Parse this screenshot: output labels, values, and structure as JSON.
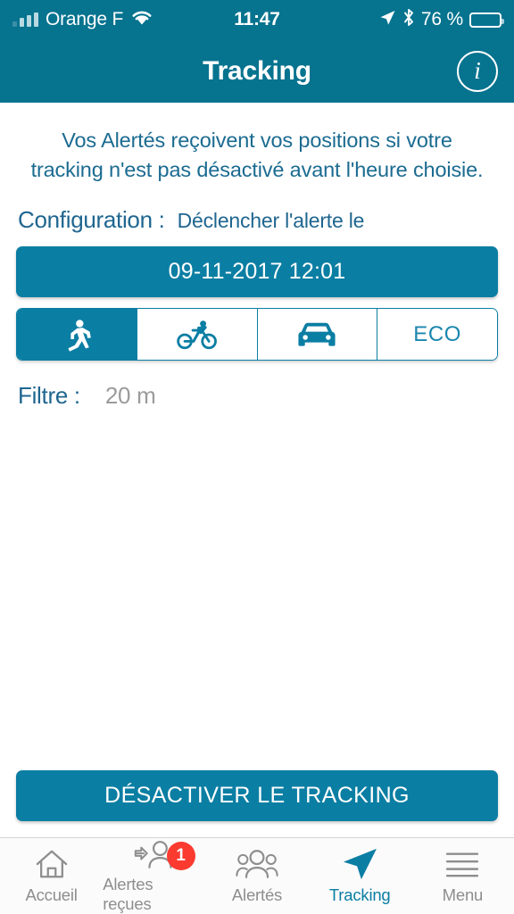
{
  "status_bar": {
    "carrier": "Orange F",
    "time": "11:47",
    "battery_percent_label": "76 %",
    "battery_level": 76,
    "signal_icon": "signal-bars-icon",
    "wifi_icon": "wifi-icon",
    "location_icon": "location-arrow-icon",
    "bluetooth_icon": "bluetooth-icon",
    "battery_icon": "battery-icon"
  },
  "nav": {
    "title": "Tracking",
    "info_label": "i",
    "info_icon": "info-circle-icon"
  },
  "main": {
    "intro": "Vos Alertés reçoivent vos positions si votre tracking n'est pas désactivé avant l'heure choisie.",
    "config_label": "Configuration :",
    "config_value": "Déclencher l'alerte le",
    "date_value": "09-11-2017 12:01",
    "filter_label": "Filtre :",
    "filter_value": "20 m",
    "modes": [
      {
        "id": "walk",
        "icon": "running-person-icon",
        "label": "",
        "selected": true
      },
      {
        "id": "bike",
        "icon": "bicycle-icon",
        "label": "",
        "selected": false
      },
      {
        "id": "car",
        "icon": "car-icon",
        "label": "",
        "selected": false
      },
      {
        "id": "eco",
        "icon": "",
        "label": "ECO",
        "selected": false
      }
    ],
    "action_label": "DÉSACTIVER LE TRACKING"
  },
  "tabs": [
    {
      "label": "Accueil",
      "icon": "home-icon",
      "active": false,
      "badge": ""
    },
    {
      "label": "Alertes reçues",
      "icon": "incoming-alert-person-icon",
      "active": false,
      "badge": "1"
    },
    {
      "label": "Alertés",
      "icon": "people-group-icon",
      "active": false,
      "badge": ""
    },
    {
      "label": "Tracking",
      "icon": "navigation-arrow-icon",
      "active": true,
      "badge": ""
    },
    {
      "label": "Menu",
      "icon": "hamburger-menu-icon",
      "active": false,
      "badge": ""
    }
  ],
  "colors": {
    "brand_teal": "#0b7ea3",
    "header_teal": "#06738f",
    "text_blue": "#1f6690",
    "badge_red": "#fb3b30",
    "muted_gray": "#9b9b9b"
  }
}
